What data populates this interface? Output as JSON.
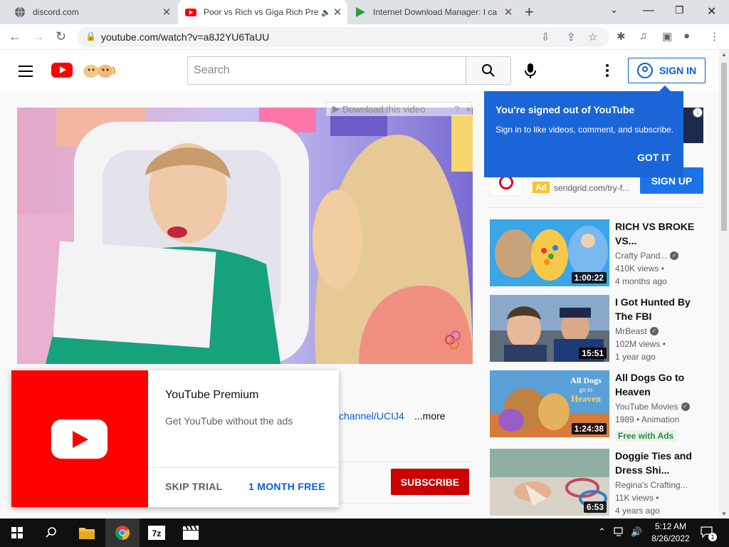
{
  "browser": {
    "tabs": [
      {
        "title": "discord.com",
        "active": false
      },
      {
        "title": "Poor vs Rich vs Giga Rich Pre",
        "active": true
      },
      {
        "title": "Internet Download Manager: I ca",
        "active": false
      }
    ],
    "url": "youtube.com/watch?v=a8J2YU6TaUU"
  },
  "header": {
    "search_placeholder": "Search",
    "sign_in": "SIGN IN"
  },
  "player": {
    "download_bar": "Download this video",
    "download_help": "?",
    "download_close": "×"
  },
  "description": {
    "link_fragment": "channel/UCIJ4",
    "more": "...more"
  },
  "subscribe": "SUBSCRIBE",
  "premium_promo": {
    "title": "YouTube Premium",
    "subtitle": "Get YouTube without the ads",
    "skip": "SKIP TRIAL",
    "free": "1 MONTH FREE"
  },
  "signin_tooltip": {
    "title": "You're signed out of YouTube",
    "text": "Sign in to like videos, comment, and subscribe.",
    "button": "GOT IT"
  },
  "ad": {
    "badge": "Ad",
    "url": "sendgrid.com/try-f...",
    "cta": "SIGN UP",
    "info": "i"
  },
  "recommendations": [
    {
      "title": "RICH VS BROKE VS...",
      "channel": "Crafty Pand...",
      "verified": true,
      "views": "410K views •",
      "age": "4 months ago",
      "duration": "1:00:22"
    },
    {
      "title": "I Got Hunted By The FBI",
      "channel": "MrBeast",
      "verified": true,
      "views": "102M views •",
      "age": "1 year ago",
      "duration": "15:51"
    },
    {
      "title": "All Dogs Go to Heaven",
      "channel": "YouTube Movies",
      "verified": true,
      "views": "1989 • Animation",
      "badge": "Free with Ads",
      "duration": "1:24:38"
    },
    {
      "title": "Doggie Ties and Dress Shi...",
      "channel": "Regina's Crafting...",
      "verified": false,
      "views": "11K views •",
      "age": "4 years ago",
      "duration": "6:53"
    }
  ],
  "taskbar": {
    "time": "5:12 AM",
    "date": "8/26/2022",
    "notifications": "1"
  },
  "colors": {
    "youtube_red": "#ff0000",
    "link_blue": "#065fd4",
    "tooltip_blue": "#1a66d9",
    "subscribe_red": "#cc0000"
  }
}
